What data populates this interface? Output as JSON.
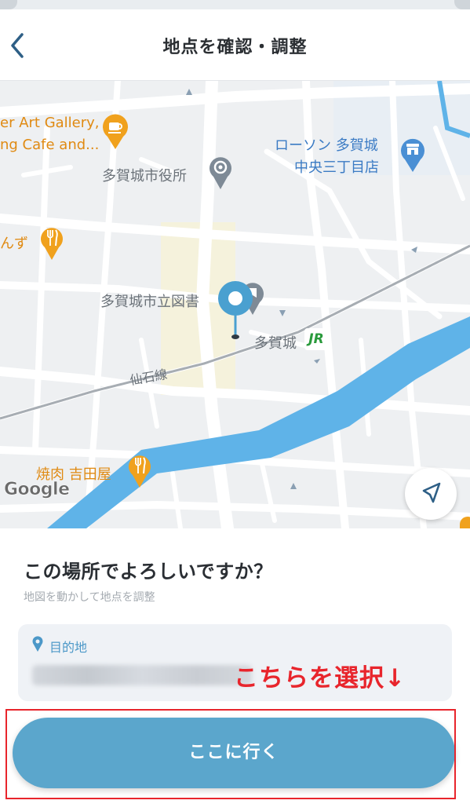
{
  "header": {
    "title": "地点を確認・調整",
    "back_icon": "chevron-left-icon"
  },
  "map": {
    "labels": {
      "art_gallery_1": "er Art Gallery,",
      "art_gallery_2": "ng Cafe and...",
      "city_hall": "多賀城市役所",
      "lawson_1": "ローソン 多賀城",
      "lawson_2": "中央三丁目店",
      "nzu": "んず",
      "library": "多賀城市立図書",
      "station": "多賀城",
      "jr_badge": "JR",
      "line": "仙石線",
      "yakiniku": "焼肉 吉田屋",
      "google": "Google"
    },
    "colors": {
      "road": "#ffffff",
      "land": "#eef0f2",
      "river": "#5fb3e8",
      "poi_orange": "#f0a11d",
      "pin_blue": "#4aa0d0",
      "poi_blue": "#4a8fd4"
    }
  },
  "sheet": {
    "question": "この場所でよろしいですか？",
    "hint": "地図を動かして地点を調整",
    "destination_label": "目的地",
    "go_button": "ここに行く"
  },
  "annotation": {
    "text": "こちらを選択↓",
    "color": "#e8252c"
  }
}
